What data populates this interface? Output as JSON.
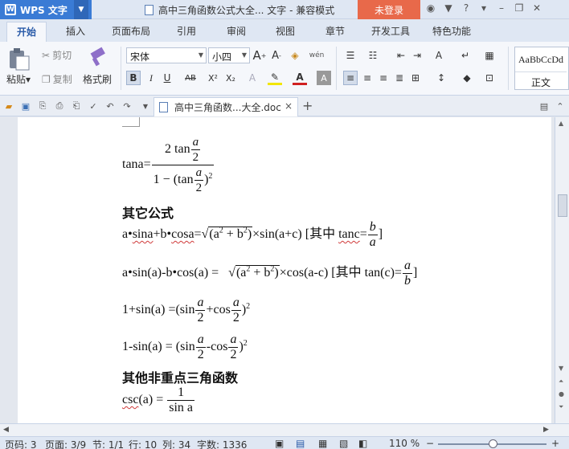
{
  "titlebar": {
    "app_name": "WPS 文字",
    "document_title": "高中三角函数公式大全... 文字 - 兼容模式",
    "login_label": "未登录",
    "icons": [
      "skin-icon",
      "shirt-icon",
      "help-icon",
      "minimize-icon",
      "restore-icon",
      "close-icon"
    ],
    "help": "?"
  },
  "menu": {
    "tabs": [
      "开始",
      "插入",
      "页面布局",
      "引用",
      "审阅",
      "视图",
      "章节",
      "开发工具",
      "特色功能"
    ],
    "active": "开始"
  },
  "ribbon": {
    "paste": "粘贴",
    "cut": "剪切",
    "copy": "复制",
    "format_painter": "格式刷",
    "font_name": "宋体",
    "font_size": "小四",
    "style_preview": "AaBbCcDd",
    "style_name": "正文",
    "format_buttons": [
      "B",
      "I",
      "U",
      "AB",
      "X²",
      "X₂",
      "A"
    ]
  },
  "doc_tab": {
    "name": "高中三角函数...大全.doc",
    "close": "×"
  },
  "content": {
    "heading1": "其它公式",
    "heading2": "其他非重点三角函数",
    "line_tana": "tana=",
    "num_2tan": "2 tan",
    "den_1": "1 − (tan",
    "den_close": ")",
    "den_sq": "2",
    "a": "a",
    "b": "b",
    "two": "2",
    "l1_part1": "a•",
    "l1_sina": "sina",
    "l1_part2": "+b•",
    "l1_cosa": "cosa",
    "l1_part3": "=",
    "rad_expr": "(a",
    "rad_plus": " + b",
    "rad_close": ")",
    "sq": "2",
    "l1_part4": "×sin(a+c) [其中 ",
    "l1_tanc": "tanc",
    "l1_eq": "=",
    "bracket_close": "]",
    "l2_part1": "a•sin(a)-b•cos(a) = ",
    "l2_part2": "×cos(a-c) [其中 tan(c)=",
    "l3_part1": "1+sin(a) =(sin",
    "l3_plus": "+cos",
    "l3_close": ")",
    "l4_part1": "1-sin(a) = (sin",
    "l4_minus": "-cos",
    "l4_close": ")",
    "csc": "csc",
    "csc_rest": "(a) = ",
    "csc_num": "1",
    "csc_den": "sin a"
  },
  "status": {
    "page_num": "页码: 3",
    "page": "页面: 3/9",
    "section": "节: 1/1",
    "row": "行: 10",
    "col": "列: 34",
    "words": "字数: 1336",
    "zoom": "110 %",
    "zoom_minus": "−",
    "zoom_plus": "+"
  }
}
